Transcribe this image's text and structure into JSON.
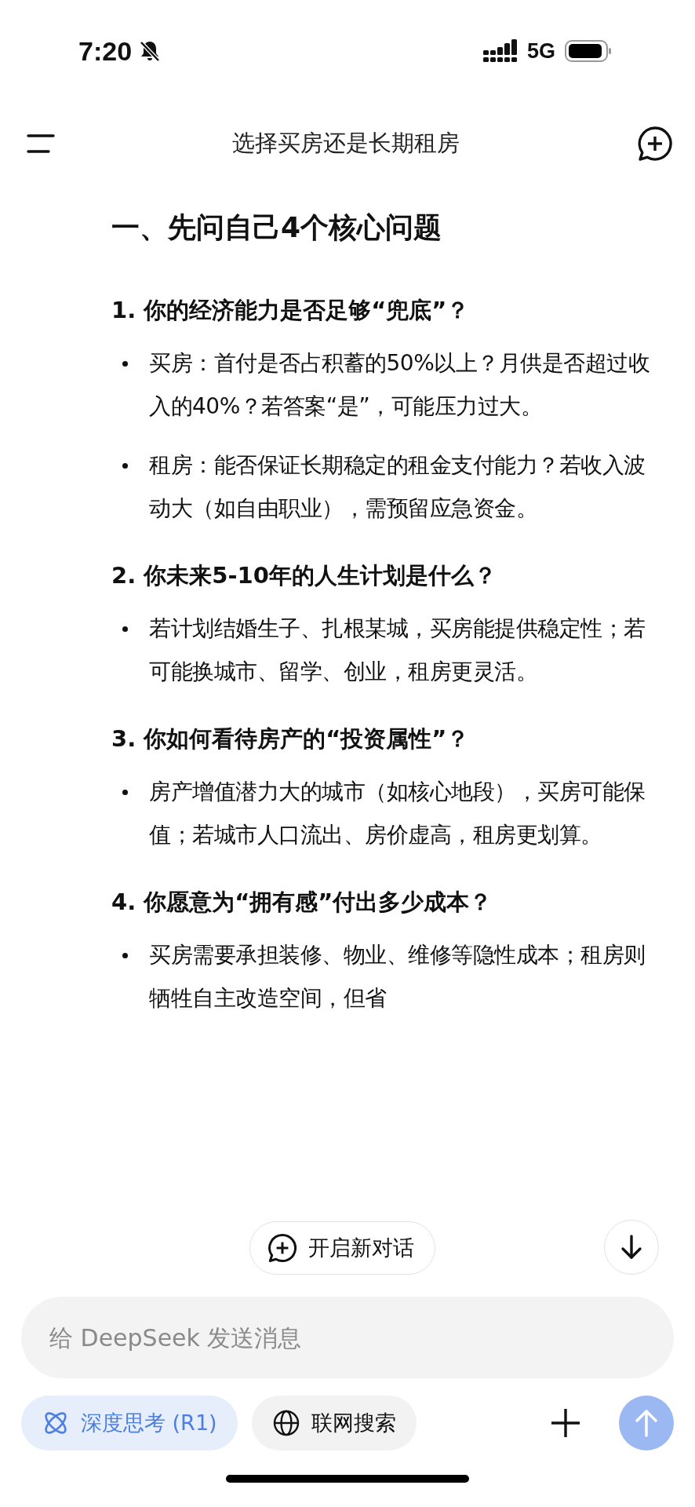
{
  "status_bar": {
    "time": "7:20",
    "network": "5G"
  },
  "header": {
    "title": "选择买房还是长期租房"
  },
  "heading": "一、先问自己4个核心问题",
  "sections": [
    {
      "question": "1. 你的经济能力是否足够“兜底”？",
      "bullets": [
        "买房：首付是否占积蓄的50%以上？月供是否超过收入的40%？若答案“是”，可能压力过大。",
        "租房：能否保证长期稳定的租金支付能力？若收入波动大（如自由职业），需预留应急资金。"
      ]
    },
    {
      "question": "2. 你未来5-10年的人生计划是什么？",
      "bullets": [
        "若计划结婚生子、扎根某城，买房能提供稳定性；若可能换城市、留学、创业，租房更灵活。"
      ]
    },
    {
      "question": "3. 你如何看待房产的“投资属性”？",
      "bullets": [
        "房产增值潜力大的城市（如核心地段），买房可能保值；若城市人口流出、房价虚高，租房更划算。"
      ]
    },
    {
      "question": "4. 你愿意为“拥有感”付出多少成本？",
      "bullets": [
        "买房需要承担装修、物业、维修等隐性成本；租房则牺牲自主改造空间，但省"
      ]
    }
  ],
  "new_chat_button": "开启新对话",
  "composer": {
    "placeholder": "给 DeepSeek 发送消息"
  },
  "chips": [
    {
      "kind": "deep-think",
      "label": "深度思考 (R1)",
      "selected": true
    },
    {
      "kind": "web-search",
      "label": "联网搜索",
      "selected": false
    }
  ]
}
